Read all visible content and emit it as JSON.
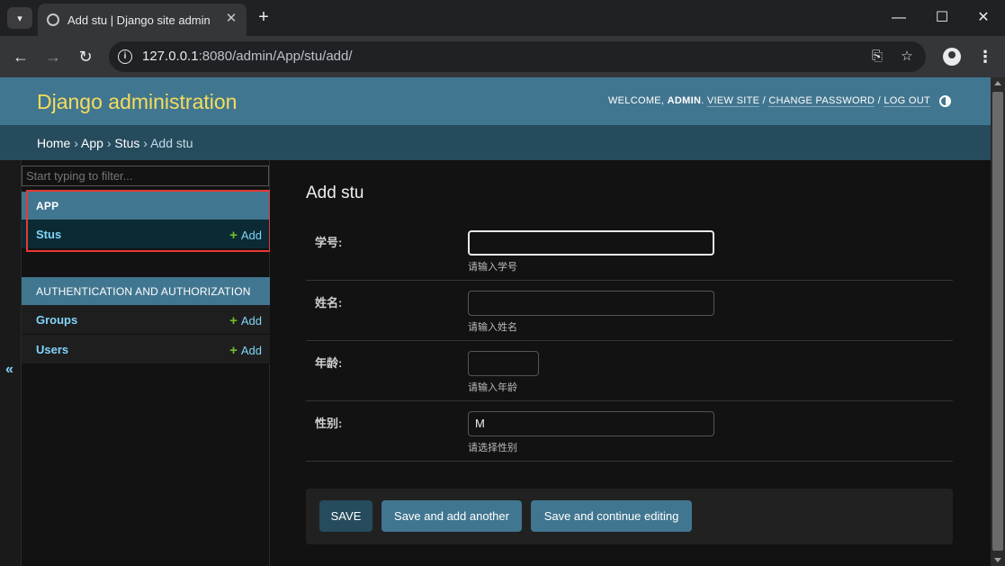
{
  "browser": {
    "tab_title": "Add stu | Django site admin",
    "url_host": "127.0.0.1",
    "url_rest": ":8080/admin/App/stu/add/"
  },
  "header": {
    "branding": "Django administration",
    "welcome": "WELCOME,",
    "username": "ADMIN",
    "view_site": "VIEW SITE",
    "change_password": "CHANGE PASSWORD",
    "log_out": "LOG OUT"
  },
  "breadcrumbs": {
    "home": "Home",
    "app": "App",
    "model": "Stus",
    "current": "Add stu"
  },
  "sidebar": {
    "filter_placeholder": "Start typing to filter...",
    "modules": [
      {
        "caption": "APP",
        "rows": [
          {
            "name": "Stus",
            "add": "Add"
          }
        ]
      },
      {
        "caption": "AUTHENTICATION AND AUTHORIZATION",
        "rows": [
          {
            "name": "Groups",
            "add": "Add"
          },
          {
            "name": "Users",
            "add": "Add"
          }
        ]
      }
    ],
    "toggle": "«"
  },
  "content": {
    "title": "Add stu",
    "fields": [
      {
        "label": "学号:",
        "value": "",
        "help": "请输入学号"
      },
      {
        "label": "姓名:",
        "value": "",
        "help": "请输入姓名"
      },
      {
        "label": "年龄:",
        "value": "",
        "help": "请输入年龄"
      },
      {
        "label": "性别:",
        "value": "M",
        "help": "请选择性别"
      }
    ],
    "buttons": {
      "save": "SAVE",
      "save_add_another": "Save and add another",
      "save_continue": "Save and continue editing"
    }
  },
  "colors": {
    "header_bg": "#417690",
    "branding": "#f5dd5d",
    "breadcrumb_bg": "#264b5d",
    "link": "#81d4fa",
    "add_plus": "#70bf2b",
    "highlight": "#e53935"
  }
}
